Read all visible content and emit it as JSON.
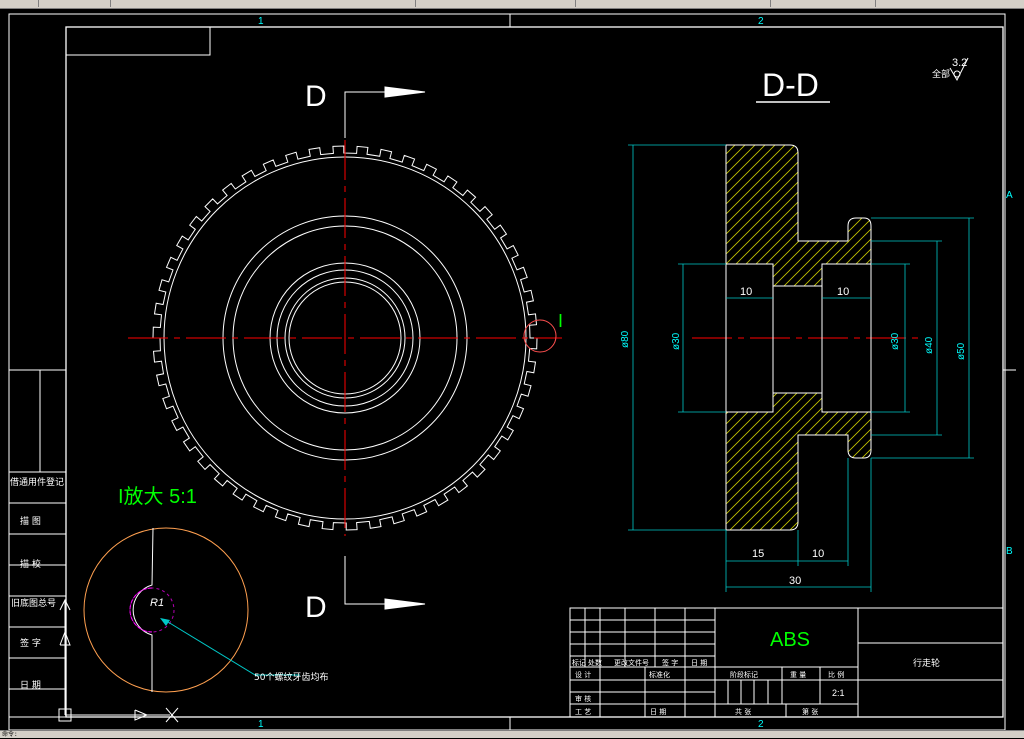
{
  "status_bar": {
    "text": "命令:"
  },
  "border_labels": {
    "col_1": "1",
    "col_2": "2",
    "row_a": "A",
    "row_b": "B"
  },
  "section": {
    "cut_letter_top": "D",
    "cut_letter_bottom": "D",
    "view_title": "D-D"
  },
  "roughness": {
    "prefix": "全部",
    "value": "3.2"
  },
  "detail": {
    "marker": "I",
    "title": "I放大 5:1",
    "radius_label": "R1",
    "leader_note": "50个螺纹牙齿均布"
  },
  "dimensions": {
    "d80": "ø80",
    "d30_left": "ø30",
    "d30_right": "ø30",
    "d40": "ø40",
    "d50": "ø50",
    "w10_left": "10",
    "w10_right": "10",
    "w15": "15",
    "w10_bottom": "10",
    "w30": "30"
  },
  "side_table": {
    "rows": [
      "借通用件登记",
      "描 图",
      "描 校",
      "旧底图总号",
      "签 字",
      "日 期"
    ]
  },
  "title_block": {
    "material": "ABS",
    "part_name": "行走轮",
    "scale": "2:1",
    "header_cells": [
      "标记",
      "处数",
      "更改文件号",
      "签 字",
      "日 期"
    ],
    "row_labels": [
      "设 计",
      "标准化",
      "审 核",
      "工 艺",
      "日 期"
    ],
    "stage_label": "阶段标记",
    "weight_label": "重 量",
    "ratio_label": "比 例",
    "sheet_total": "共  张",
    "sheet_no": "第  张"
  }
}
